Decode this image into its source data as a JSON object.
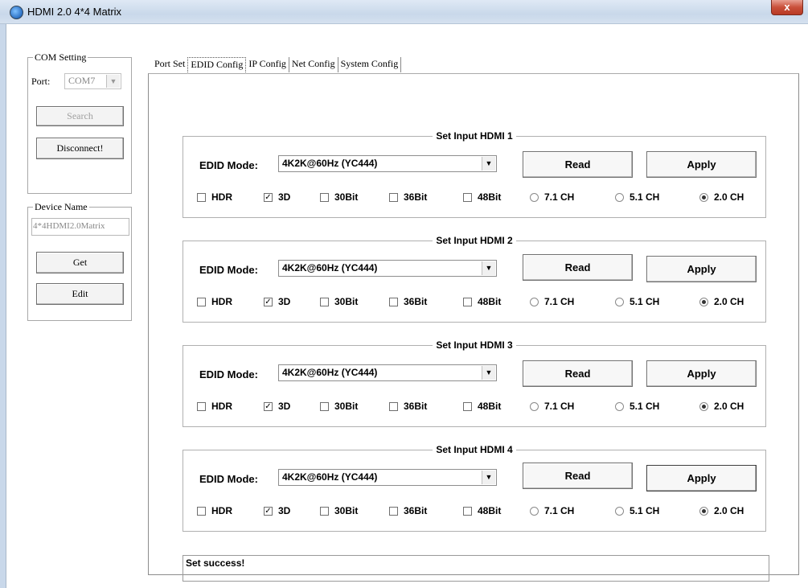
{
  "window": {
    "title": "HDMI 2.0 4*4 Matrix",
    "close_label": "x"
  },
  "com_setting": {
    "legend": "COM Setting",
    "port_label": "Port:",
    "port_value": "COM7",
    "search_label": "Search",
    "disconnect_label": "Disconnect!"
  },
  "device_name": {
    "legend": "Device Name",
    "value": "4*4HDMI2.0Matrix",
    "get_label": "Get",
    "edit_label": "Edit"
  },
  "tabs": [
    {
      "label": "Port Set"
    },
    {
      "label": "EDID Config"
    },
    {
      "label": "IP Config"
    },
    {
      "label": "Net Config"
    },
    {
      "label": "System Config"
    }
  ],
  "active_tab": "EDID Config",
  "edid_groups": [
    {
      "title": "Set Input HDMI  1",
      "edid_label": "EDID Mode:",
      "mode": "4K2K@60Hz (YC444)",
      "read_label": "Read",
      "apply_label": "Apply",
      "options": {
        "hdr": "HDR",
        "d3": "3D",
        "bit30": "30Bit",
        "bit36": "36Bit",
        "bit48": "48Bit",
        "ch71": "7.1 CH",
        "ch51": "5.1 CH",
        "ch20": "2.0 CH"
      }
    },
    {
      "title": "Set Input HDMI  2",
      "edid_label": "EDID Mode:",
      "mode": "4K2K@60Hz (YC444)",
      "read_label": "Read",
      "apply_label": "Apply",
      "options": {
        "hdr": "HDR",
        "d3": "3D",
        "bit30": "30Bit",
        "bit36": "36Bit",
        "bit48": "48Bit",
        "ch71": "7.1 CH",
        "ch51": "5.1 CH",
        "ch20": "2.0 CH"
      }
    },
    {
      "title": "Set Input HDMI  3",
      "edid_label": "EDID Mode:",
      "mode": "4K2K@60Hz (YC444)",
      "read_label": "Read",
      "apply_label": "Apply",
      "options": {
        "hdr": "HDR",
        "d3": "3D",
        "bit30": "30Bit",
        "bit36": "36Bit",
        "bit48": "48Bit",
        "ch71": "7.1 CH",
        "ch51": "5.1 CH",
        "ch20": "2.0 CH"
      }
    },
    {
      "title": "Set Input HDMI  4",
      "edid_label": "EDID Mode:",
      "mode": "4K2K@60Hz (YC444)",
      "read_label": "Read",
      "apply_label": "Apply",
      "options": {
        "hdr": "HDR",
        "d3": "3D",
        "bit30": "30Bit",
        "bit36": "36Bit",
        "bit48": "48Bit",
        "ch71": "7.1 CH",
        "ch51": "5.1 CH",
        "ch20": "2.0 CH"
      }
    }
  ],
  "checked": {
    "hdr": false,
    "d3": true,
    "bit30": false,
    "bit36": false,
    "bit48": false
  },
  "selected_channel": "2.0 CH",
  "status": "Set success!"
}
